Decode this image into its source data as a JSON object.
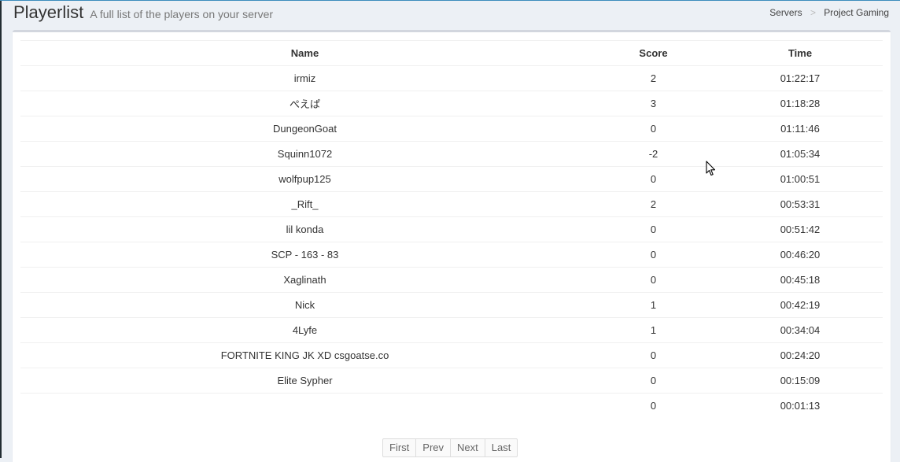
{
  "header": {
    "title": "Playerlist",
    "subtitle": "A full list of the players on your server",
    "breadcrumb": [
      "Servers",
      "Project Gaming"
    ]
  },
  "table": {
    "columns": [
      "Name",
      "Score",
      "Time"
    ],
    "rows": [
      {
        "name": "irmiz",
        "score": "2",
        "time": "01:22:17"
      },
      {
        "name": "ぺえぱ",
        "score": "3",
        "time": "01:18:28"
      },
      {
        "name": "DungeonGoat",
        "score": "0",
        "time": "01:11:46"
      },
      {
        "name": "Squinn1072",
        "score": "-2",
        "time": "01:05:34"
      },
      {
        "name": "wolfpup125",
        "score": "0",
        "time": "01:00:51"
      },
      {
        "name": "_Rift_",
        "score": "2",
        "time": "00:53:31"
      },
      {
        "name": "lil konda",
        "score": "0",
        "time": "00:51:42"
      },
      {
        "name": "SCP - 163 - 83",
        "score": "0",
        "time": "00:46:20"
      },
      {
        "name": "Xaglinath",
        "score": "0",
        "time": "00:45:18"
      },
      {
        "name": "Nick",
        "score": "1",
        "time": "00:42:19"
      },
      {
        "name": "4Lyfe",
        "score": "1",
        "time": "00:34:04"
      },
      {
        "name": "FORTNITE KING JK XD csgoatse.co",
        "score": "0",
        "time": "00:24:20"
      },
      {
        "name": "Elite Sypher",
        "score": "0",
        "time": "00:15:09"
      },
      {
        "name": "",
        "score": "0",
        "time": "00:01:13"
      }
    ]
  },
  "pagination": {
    "first": "First",
    "prev": "Prev",
    "next": "Next",
    "last": "Last"
  }
}
